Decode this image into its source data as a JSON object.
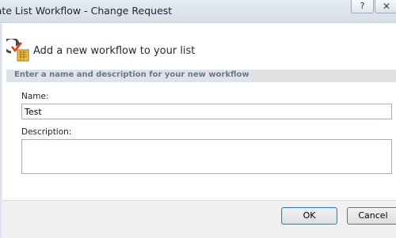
{
  "window": {
    "title": "eate List Workflow - Change Request",
    "help_label": "?",
    "close_label": "✕"
  },
  "header": {
    "icon": "workflow-icon",
    "title": "Add a new workflow to your list"
  },
  "section": {
    "heading": "Enter a name and description for your new workflow"
  },
  "form": {
    "name_label": "Name:",
    "name_value": "Test",
    "description_label": "Description:",
    "description_value": ""
  },
  "buttons": {
    "ok": "OK",
    "cancel": "Cancel"
  }
}
